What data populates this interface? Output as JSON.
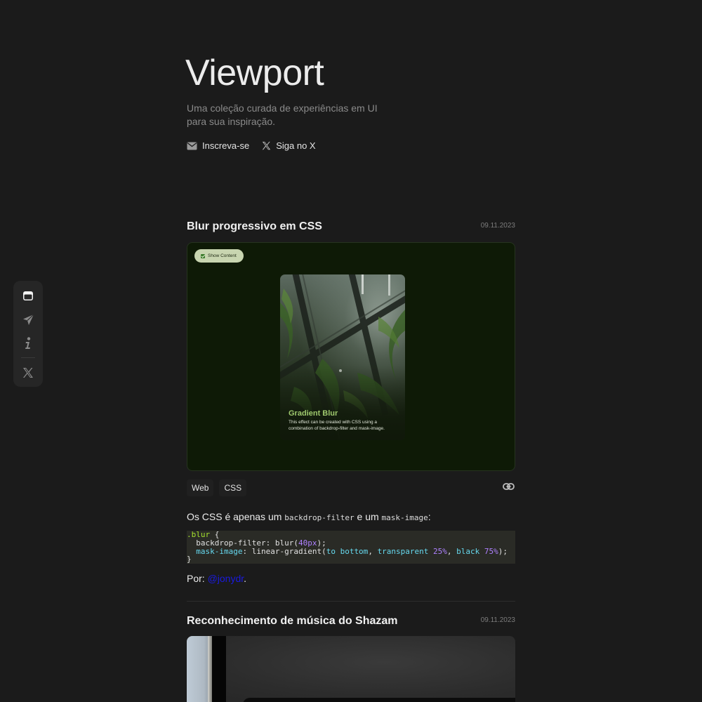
{
  "site": {
    "title": "Viewport",
    "tagline": "Uma coleção curada de experiências em UI para sua inspiração.",
    "subscribe_label": "Inscreva-se",
    "follow_label": "Siga no X"
  },
  "sidebar": {
    "items": [
      {
        "icon": "window-icon",
        "active": true
      },
      {
        "icon": "send-icon",
        "active": false
      },
      {
        "icon": "info-icon",
        "active": false
      },
      {
        "icon": "x-logo-icon",
        "active": false
      }
    ]
  },
  "posts": [
    {
      "title": "Blur progressivo em CSS",
      "date": "09.11.2023",
      "preview": {
        "button_label": "Show Content",
        "card_title": "Gradient Blur",
        "card_desc": "This effect can be created with CSS using a combination of backdrop-filter and mask-image."
      },
      "tags": [
        "Web",
        "CSS"
      ],
      "desc_pre": "Os CSS é apenas um ",
      "desc_code1": "backdrop-filter",
      "desc_mid": " e um ",
      "desc_code2": "mask-image",
      "desc_end": ":",
      "code": {
        "l1_sel": ".blur",
        "l1_rest": " {",
        "l2_a": "  backdrop-filter: blur(",
        "l2_num": "40px",
        "l2_b": ");",
        "l3_indent": "  ",
        "l3_prop": "mask-image",
        "l3_a": ": linear-gradient(",
        "l3_to": "to bottom",
        "l3_c1": ", ",
        "l3_tr": "transparent",
        "l3_sp1": " ",
        "l3_p1": "25%",
        "l3_c2": ", ",
        "l3_bl": "black",
        "l3_sp2": " ",
        "l3_p2": "75%",
        "l3_end": ");",
        "l4": "}"
      },
      "author_prefix": "Por: ",
      "author": "@jonydr",
      "author_suffix": "."
    },
    {
      "title": "Reconhecimento de música do Shazam",
      "date": "09.11.2023"
    }
  ],
  "colors": {
    "background": "#1b1b1b",
    "preview_bg": "#0e1a06",
    "accent_green": "#9ec86d",
    "link_blue": "#1a1adf"
  }
}
